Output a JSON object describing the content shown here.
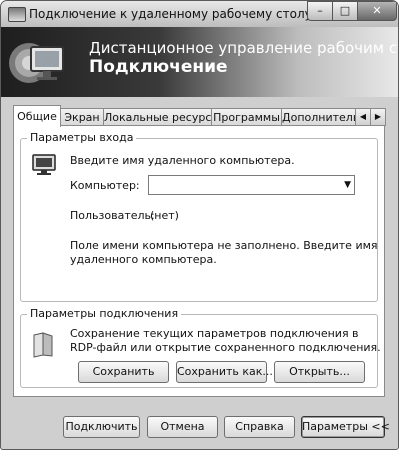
{
  "window": {
    "title": "Подключение к удаленному рабочему столу"
  },
  "title_controls": {
    "minimize": "–",
    "maximize": "□",
    "close": "✕"
  },
  "banner": {
    "line1": "Дистанционное управление рабочим столом",
    "line2": "Подключение"
  },
  "tabs": [
    {
      "label": "Общие",
      "active": true
    },
    {
      "label": "Экран",
      "active": false
    },
    {
      "label": "Локальные ресурсы",
      "active": false
    },
    {
      "label": "Программы",
      "active": false
    },
    {
      "label": "Дополнительно",
      "active": false
    }
  ],
  "tab_scroll": {
    "left": "◀",
    "right": "▶"
  },
  "login_group": {
    "title": "Параметры входа",
    "prompt": "Введите имя удаленного компьютера.",
    "computer_label": "Компьютер:",
    "computer_value": "",
    "user_label": "Пользователь:",
    "user_value": "(нет)",
    "message_line1": "Поле имени компьютера не заполнено. Введите имя",
    "message_line2": "удаленного компьютера."
  },
  "connection_group": {
    "title": "Параметры подключения",
    "desc_line1": "Сохранение текущих параметров подключения в",
    "desc_line2": "RDP-файл или открытие сохраненного подключения.",
    "save_button": "Сохранить",
    "save_as_button": "Сохранить как...",
    "open_button": "Открыть..."
  },
  "footer": {
    "connect_button": "Подключить",
    "cancel_button": "Отмена",
    "help_button": "Справка",
    "options_button": "Параметры <<"
  }
}
